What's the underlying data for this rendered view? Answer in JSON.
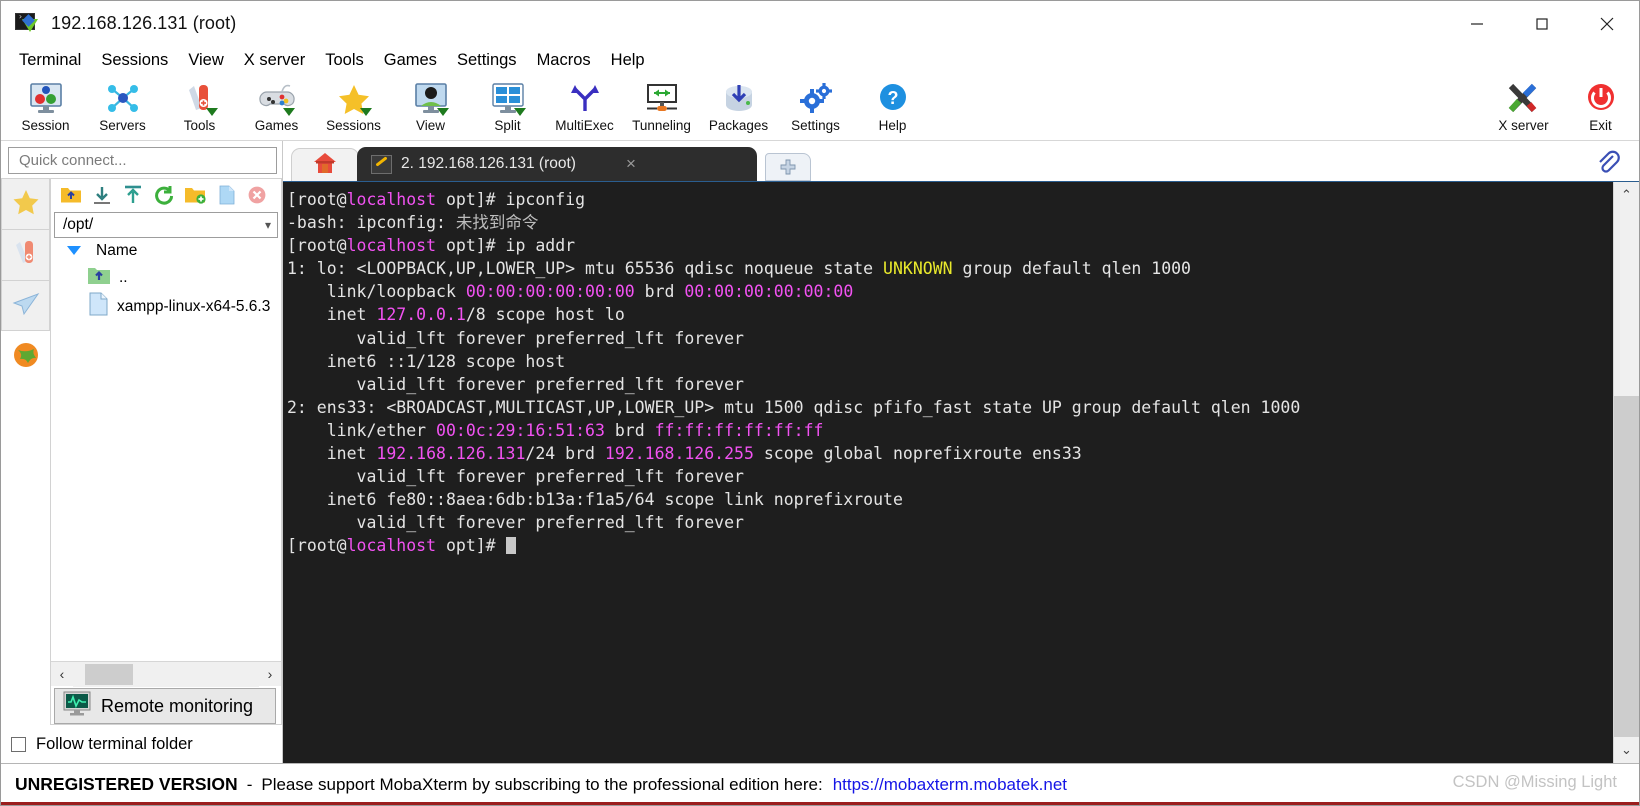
{
  "window": {
    "title": "192.168.126.131 (root)",
    "icon": "mobaxterm-logo-icon",
    "minimize": "—",
    "maximize": "□",
    "close": "×"
  },
  "menubar": {
    "items": [
      {
        "label": "Terminal"
      },
      {
        "label": "Sessions"
      },
      {
        "label": "View"
      },
      {
        "label": "X server"
      },
      {
        "label": "Tools"
      },
      {
        "label": "Games"
      },
      {
        "label": "Settings"
      },
      {
        "label": "Macros"
      },
      {
        "label": "Help"
      }
    ]
  },
  "toolbar": {
    "items": [
      {
        "label": "Session",
        "icon": "session-monitor-icon",
        "dropdown": false
      },
      {
        "label": "Servers",
        "icon": "servers-network-icon",
        "dropdown": false
      },
      {
        "label": "Tools",
        "icon": "swiss-knife-icon",
        "dropdown": true
      },
      {
        "label": "Games",
        "icon": "gamepad-icon",
        "dropdown": true
      },
      {
        "label": "Sessions",
        "icon": "star-icon",
        "dropdown": true
      },
      {
        "label": "View",
        "icon": "user-screen-icon",
        "dropdown": true
      },
      {
        "label": "Split",
        "icon": "split-screen-icon",
        "dropdown": true
      },
      {
        "label": "MultiExec",
        "icon": "multiexec-fork-icon",
        "dropdown": false
      },
      {
        "label": "Tunneling",
        "icon": "tunneling-icon",
        "dropdown": false
      },
      {
        "label": "Packages",
        "icon": "packages-download-icon",
        "dropdown": false
      },
      {
        "label": "Settings",
        "icon": "gears-icon",
        "dropdown": false
      },
      {
        "label": "Help",
        "icon": "help-question-icon",
        "dropdown": false
      }
    ],
    "right_items": [
      {
        "label": "X server",
        "icon": "x-server-icon"
      },
      {
        "label": "Exit",
        "icon": "power-exit-icon"
      }
    ]
  },
  "sidebar": {
    "quick_connect_placeholder": "Quick connect...",
    "vtabs": [
      {
        "name": "sessions-star-tab",
        "icon": "star-icon"
      },
      {
        "name": "tools-knife-tab",
        "icon": "swiss-knife-icon"
      },
      {
        "name": "sftp-plane-tab",
        "icon": "paper-plane-icon"
      }
    ],
    "globe_tab": {
      "name": "globe-tab",
      "icon": "globe-icon"
    },
    "browser_toolbar": [
      {
        "name": "up-folder-button",
        "icon": "folder-up-icon"
      },
      {
        "name": "download-button",
        "icon": "download-arrow-icon"
      },
      {
        "name": "upload-button",
        "icon": "upload-arrow-icon"
      },
      {
        "name": "refresh-button",
        "icon": "refresh-circle-icon"
      },
      {
        "name": "new-folder-button",
        "icon": "new-folder-icon"
      },
      {
        "name": "new-file-button",
        "icon": "new-file-icon"
      },
      {
        "name": "delete-button",
        "icon": "delete-x-icon"
      }
    ],
    "path": "/opt/",
    "column_header": "Name",
    "files": [
      {
        "name": "..",
        "icon": "parent-folder-icon"
      },
      {
        "name": "xampp-linux-x64-5.6.3",
        "icon": "file-icon"
      }
    ],
    "hscroll": {
      "left": "‹",
      "right": "›"
    },
    "remote_monitoring": {
      "label": "Remote monitoring",
      "icon": "monitor-graph-icon"
    },
    "follow_terminal_folder": {
      "label": "Follow terminal folder",
      "checked": false
    }
  },
  "tabs": {
    "home_tab": {
      "name": "home-tab",
      "icon": "home-icon"
    },
    "active_tab": {
      "label": "2. 192.168.126.131 (root)",
      "icon": "terminal-key-icon",
      "close": "×"
    },
    "new_tab": {
      "label": "➕",
      "icon": "plus-icon"
    },
    "clip_icon": "paperclip-icon"
  },
  "terminal": {
    "bg": "#1e1e1e",
    "fg": "#e4e4e4",
    "colors": {
      "magenta": "#f152f1",
      "yellow": "#e8e82c",
      "grey": "#bdbdbd"
    },
    "lines": [
      [
        {
          "t": "[root@",
          "c": "white"
        },
        {
          "t": "localhost",
          "c": "magenta"
        },
        {
          "t": " opt]# ipconfig",
          "c": "white"
        }
      ],
      [
        {
          "t": "-bash: ipconfig: ",
          "c": "white"
        },
        {
          "t": "未找到命令",
          "c": "grey"
        }
      ],
      [
        {
          "t": "[root@",
          "c": "white"
        },
        {
          "t": "localhost",
          "c": "magenta"
        },
        {
          "t": " opt]# ip addr",
          "c": "white"
        }
      ],
      [
        {
          "t": "1: lo: <LOOPBACK,UP,LOWER_UP> mtu 65536 qdisc noqueue state ",
          "c": "white"
        },
        {
          "t": "UNKNOWN",
          "c": "yellow"
        },
        {
          "t": " group default qlen 1000",
          "c": "white"
        }
      ],
      [
        {
          "t": "    link/loopback ",
          "c": "white"
        },
        {
          "t": "00:00:00:00:00:00",
          "c": "magenta"
        },
        {
          "t": " brd ",
          "c": "white"
        },
        {
          "t": "00:00:00:00:00:00",
          "c": "magenta"
        }
      ],
      [
        {
          "t": "    inet ",
          "c": "white"
        },
        {
          "t": "127.0.0.1",
          "c": "magenta"
        },
        {
          "t": "/8 scope host lo",
          "c": "white"
        }
      ],
      [
        {
          "t": "       valid_lft forever preferred_lft forever",
          "c": "white"
        }
      ],
      [
        {
          "t": "    inet6 ::1/128 scope host",
          "c": "white"
        }
      ],
      [
        {
          "t": "       valid_lft forever preferred_lft forever",
          "c": "white"
        }
      ],
      [
        {
          "t": "2: ens33: <BROADCAST,MULTICAST,UP,LOWER_UP> mtu 1500 qdisc pfifo_fast state UP group default qlen 1000",
          "c": "white"
        }
      ],
      [
        {
          "t": "    link/ether ",
          "c": "white"
        },
        {
          "t": "00:0c:29:16:51:63",
          "c": "magenta"
        },
        {
          "t": " brd ",
          "c": "white"
        },
        {
          "t": "ff:ff:ff:ff:ff:ff",
          "c": "magenta"
        }
      ],
      [
        {
          "t": "    inet ",
          "c": "white"
        },
        {
          "t": "192.168.126.131",
          "c": "magenta"
        },
        {
          "t": "/24 brd ",
          "c": "white"
        },
        {
          "t": "192.168.126.255",
          "c": "magenta"
        },
        {
          "t": " scope global noprefixroute ens33",
          "c": "white"
        }
      ],
      [
        {
          "t": "       valid_lft forever preferred_lft forever",
          "c": "white"
        }
      ],
      [
        {
          "t": "    inet6 fe80::8aea:6db:b13a:f1a5/64 scope link noprefixroute",
          "c": "white"
        }
      ],
      [
        {
          "t": "       valid_lft forever preferred_lft forever",
          "c": "white"
        }
      ],
      [
        {
          "t": "[root@",
          "c": "white"
        },
        {
          "t": "localhost",
          "c": "magenta"
        },
        {
          "t": " opt]# ",
          "c": "white"
        },
        {
          "t": "",
          "c": "cursor"
        }
      ]
    ],
    "scroll_up": "⌃",
    "scroll_down": "⌄"
  },
  "statusbar": {
    "unregistered": "UNREGISTERED VERSION",
    "dash": "-",
    "message": "Please support MobaXterm by subscribing to the professional edition here:",
    "link": "https://mobaxterm.mobatek.net",
    "watermark": "CSDN @Missing Light"
  }
}
